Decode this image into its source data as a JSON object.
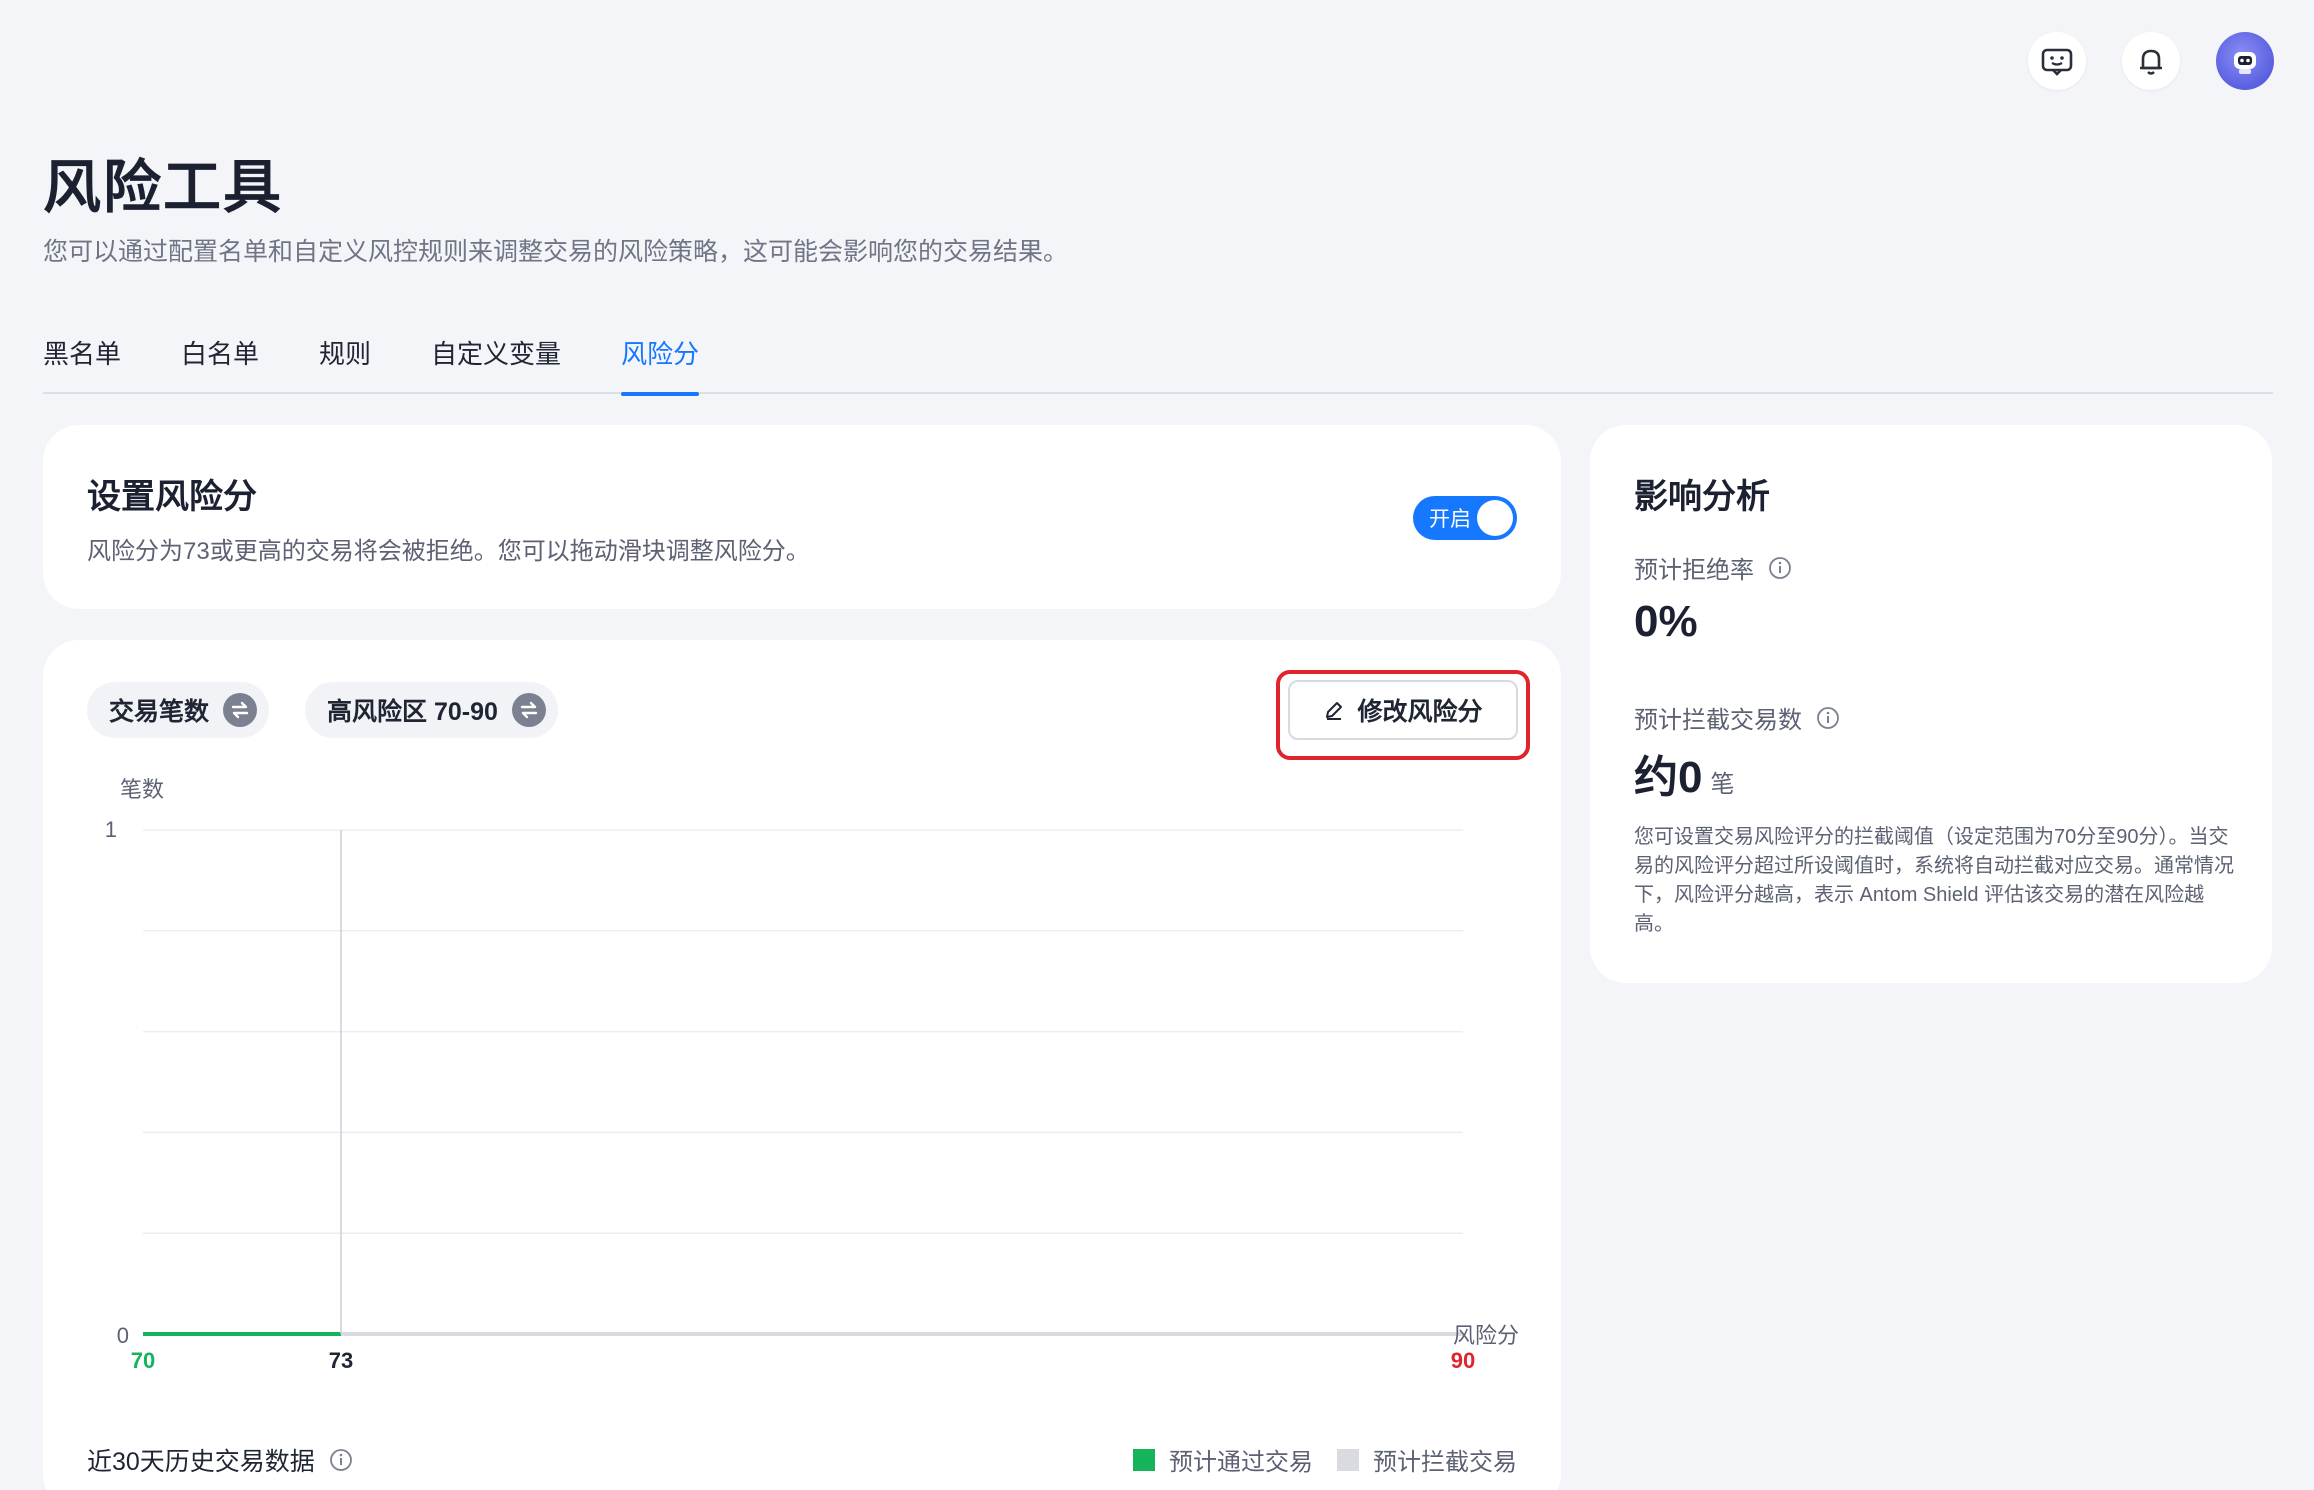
{
  "topbar": {
    "icons": [
      "feedback-icon",
      "bell-icon",
      "avatar"
    ]
  },
  "page": {
    "title": "风险工具",
    "subtitle": "您可以通过配置名单和自定义风控规则来调整交易的风险策略，这可能会影响您的交易结果。"
  },
  "tabs": [
    {
      "label": "黑名单",
      "active": false
    },
    {
      "label": "白名单",
      "active": false
    },
    {
      "label": "规则",
      "active": false
    },
    {
      "label": "自定义变量",
      "active": false
    },
    {
      "label": "风险分",
      "active": true
    }
  ],
  "settings": {
    "title": "设置风险分",
    "description": "风险分为73或更高的交易将会被拒绝。您可以拖动滑块调整风险分。",
    "toggle_label": "开启",
    "toggle_on": true
  },
  "chart_panel": {
    "chip_metric": "交易笔数",
    "chip_range": "高风险区 70-90",
    "edit_button": "修改风险分",
    "footer_label": "近30天历史交易数据",
    "legend": [
      {
        "label": "预计通过交易",
        "color": "#16b45a"
      },
      {
        "label": "预计拦截交易",
        "color": "#d9dbe1"
      }
    ]
  },
  "chart_data": {
    "type": "line",
    "ylabel": "笔数",
    "xlabel": "风险分",
    "ylim": [
      0,
      1
    ],
    "y_ticks": [
      "1",
      "0"
    ],
    "xlim": [
      70,
      90
    ],
    "x_tick_labels": {
      "min": "70",
      "threshold": "73",
      "max": "90"
    },
    "threshold": 73,
    "series": [
      {
        "segment": "pass",
        "color": "#16b45a",
        "x": [
          70,
          73
        ],
        "y": [
          0,
          0
        ]
      },
      {
        "segment": "block",
        "color": "#d9dbe1",
        "x": [
          73,
          90
        ],
        "y": [
          0,
          0
        ]
      }
    ],
    "grid": true,
    "colors": {
      "min_label": "#16b45a",
      "threshold_label": "#1f2533",
      "max_label": "#e0242b"
    }
  },
  "impact": {
    "title": "影响分析",
    "reject_rate_label": "预计拒绝率",
    "reject_rate_value": "0%",
    "blocked_count_label": "预计拦截交易数",
    "blocked_count_value": "约0",
    "blocked_count_unit": "笔",
    "note": "您可设置交易风险评分的拦截阈值（设定范围为70分至90分）。当交易的风险评分超过所设阈值时，系统将自动拦截对应交易。通常情况下，风险评分越高，表示 Antom Shield 评估该交易的潜在风险越高。"
  },
  "colors": {
    "accent": "#1677ff",
    "highlight_outline": "#e0242b"
  }
}
